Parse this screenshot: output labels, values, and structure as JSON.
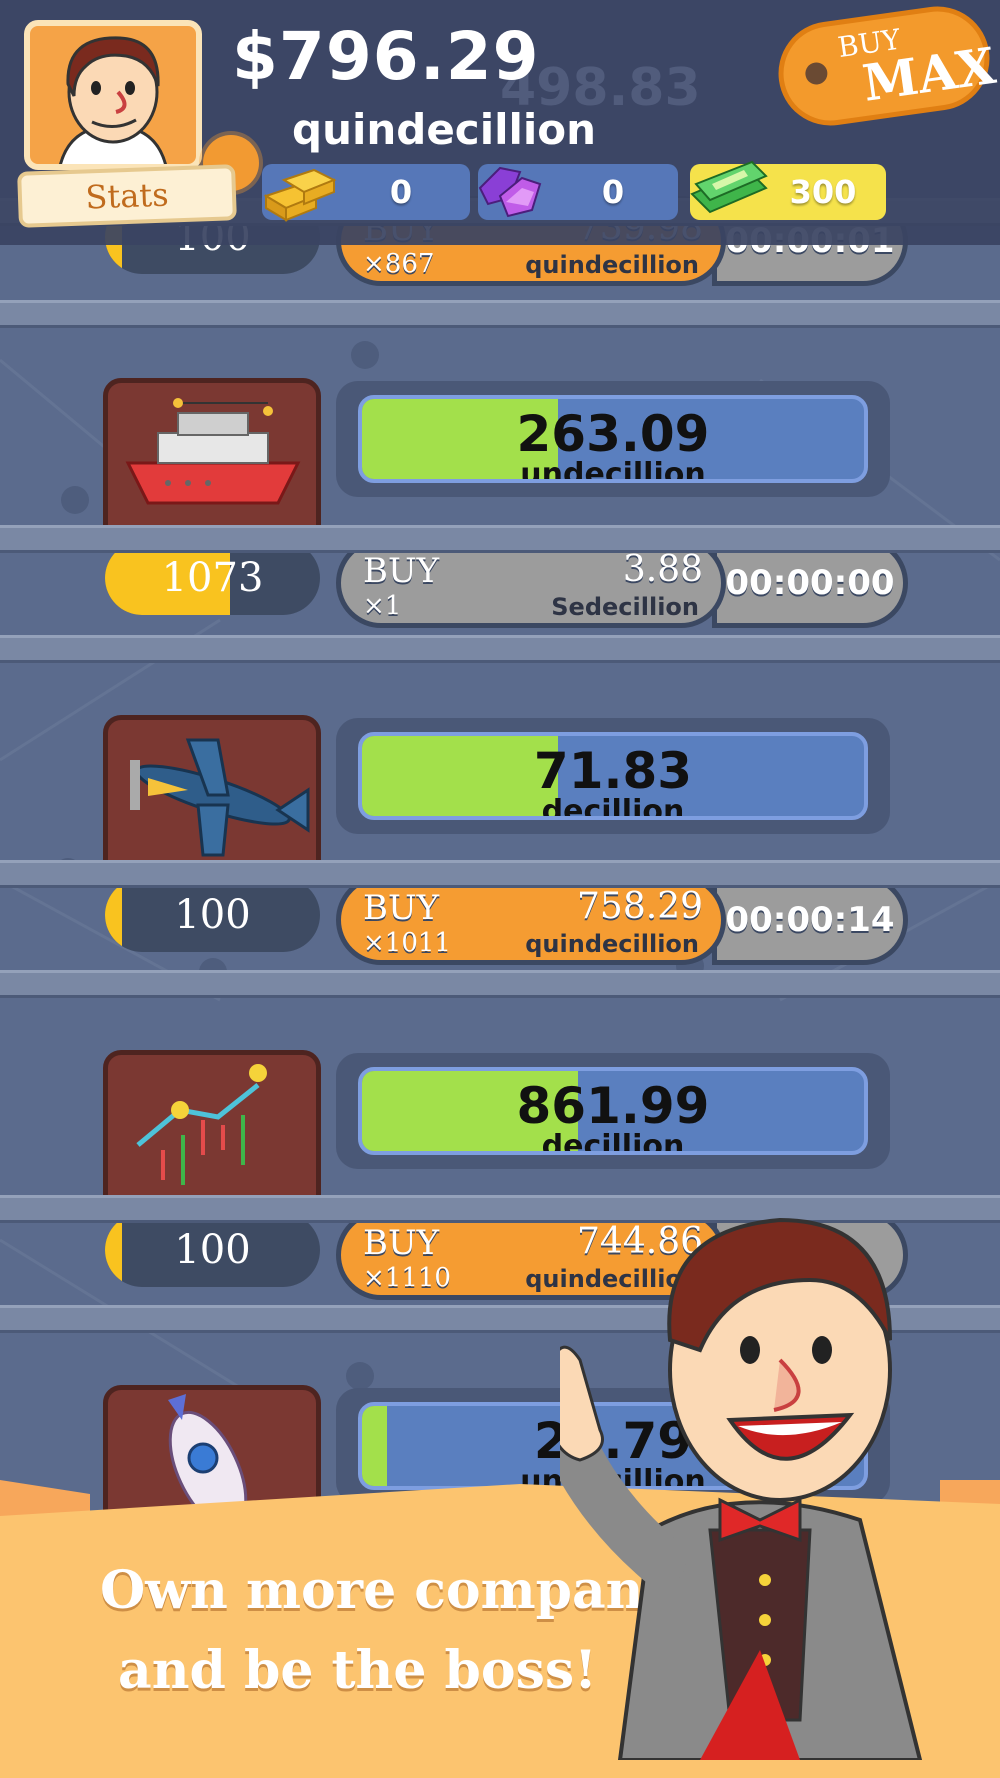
{
  "header": {
    "money_value": "$796.29",
    "money_unit": "quindecillion",
    "ghost_money": "498.83",
    "stats_label": "Stats",
    "buy_max_line1": "BUY",
    "buy_max_line2": "MAX",
    "currencies": [
      {
        "icon": "gold-bars-icon",
        "value": "0"
      },
      {
        "icon": "gems-icon",
        "value": "0"
      },
      {
        "icon": "megabucks-icon",
        "value": "300"
      }
    ]
  },
  "businesses": [
    {
      "icon": "partial-row-icon",
      "level": "100",
      "level_fraction": 0.08,
      "revenue_fraction": 0,
      "buy_label": "BUY",
      "buy_qty": "×867",
      "price_value": "739.98",
      "price_unit": "quindecillion",
      "timer": "00:00:01",
      "buy_style": "orange"
    },
    {
      "icon": "cruise-ship-icon",
      "level": "1073",
      "level_fraction": 0.58,
      "revenue_value": "263.09",
      "revenue_unit": "undecillion",
      "revenue_fraction": 0.39,
      "buy_label": "BUY",
      "buy_qty": "×1",
      "price_value": "3.88",
      "price_unit": "Sedecillion",
      "timer": "00:00:00",
      "buy_style": "gray"
    },
    {
      "icon": "airplane-icon",
      "level": "100",
      "level_fraction": 0.08,
      "revenue_value": "71.83",
      "revenue_unit": "decillion",
      "revenue_fraction": 0.39,
      "buy_label": "BUY",
      "buy_qty": "×1011",
      "price_value": "758.29",
      "price_unit": "quindecillion",
      "timer": "00:00:14",
      "buy_style": "orange"
    },
    {
      "icon": "stock-chart-icon",
      "level": "100",
      "level_fraction": 0.08,
      "revenue_value": "861.99",
      "revenue_unit": "decillion",
      "revenue_fraction": 0.43,
      "buy_label": "BUY",
      "buy_qty": "×1110",
      "price_value": "744.86",
      "price_unit": "quindecillion",
      "timer": "00:",
      "buy_style": "orange"
    },
    {
      "icon": "rocket-icon",
      "revenue_value": "23.79",
      "revenue_unit": "undecillion",
      "revenue_fraction": 0.05
    }
  ],
  "banner": {
    "line1": "Own more companies",
    "line2": "and be the boss!"
  },
  "colors": {
    "background": "#5b6b8d",
    "header": "#3a4462",
    "revenue_fill": "#a3e04b",
    "revenue_track": "#5a7fbf",
    "buy_orange": "#f59c32",
    "level_fill": "#f9c31f",
    "banner": "#fcc46f"
  }
}
